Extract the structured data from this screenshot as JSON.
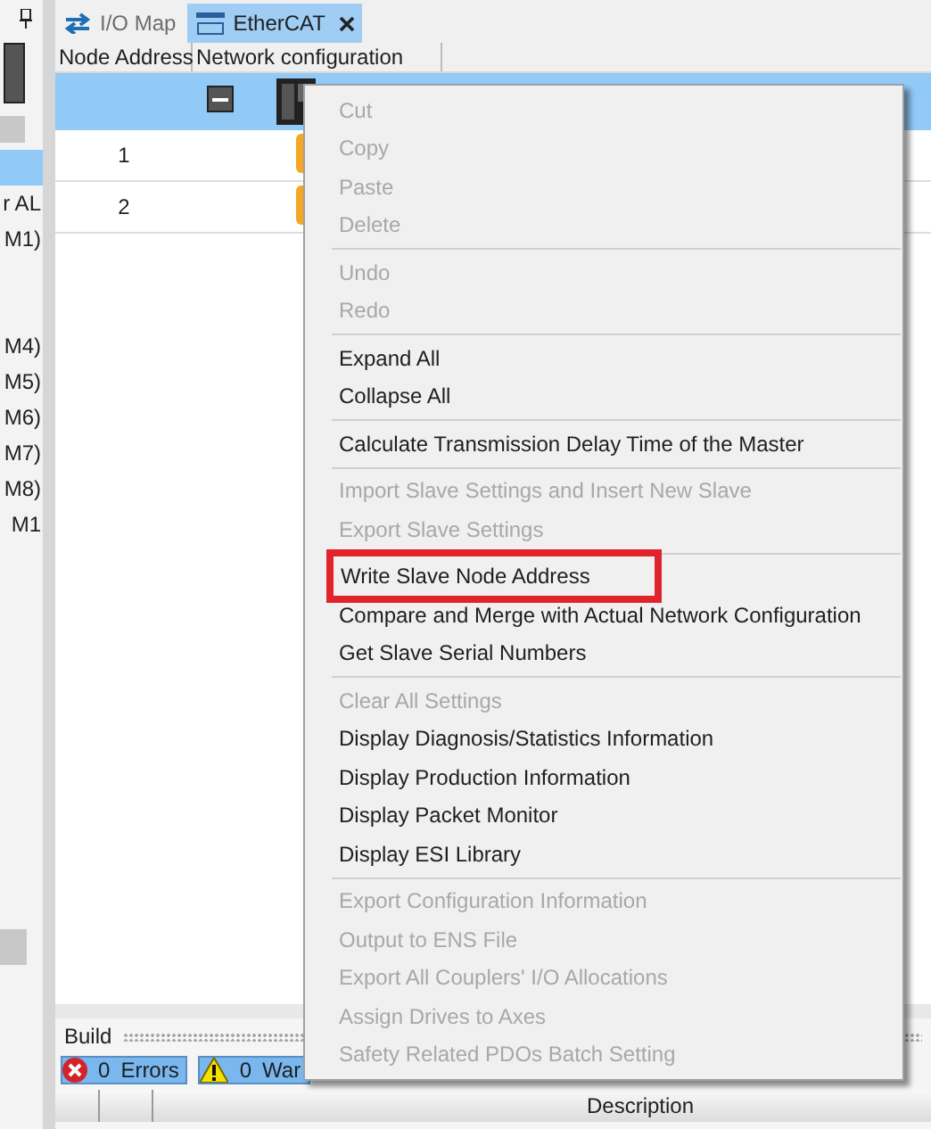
{
  "left_panel": {
    "tree_items": [
      {
        "selected": true
      },
      {
        "label": "r AL",
        "selected": false
      },
      {
        "label": "M1)",
        "selected": false
      },
      {
        "label": "M4)",
        "selected": false
      },
      {
        "label": "M5)",
        "selected": false
      },
      {
        "label": "M6)",
        "selected": false
      },
      {
        "label": "M7)",
        "selected": false
      },
      {
        "label": "M8)",
        "selected": false
      },
      {
        "label": "M1",
        "selected": false
      }
    ]
  },
  "tabs": [
    {
      "label": "I/O Map",
      "selected": false
    },
    {
      "label": "EtherCAT",
      "selected": true
    }
  ],
  "table": {
    "columns": [
      "Node Address",
      "Network configuration"
    ],
    "rows": [
      {
        "node_address": "1"
      },
      {
        "node_address": "2"
      }
    ]
  },
  "context_menu": [
    {
      "kind": "item",
      "label": "Cut",
      "disabled": true,
      "outlined": false
    },
    {
      "kind": "item",
      "label": "Copy",
      "disabled": true,
      "outlined": false
    },
    {
      "kind": "item",
      "label": "Paste",
      "disabled": true,
      "outlined": false
    },
    {
      "kind": "item",
      "label": "Delete",
      "disabled": true,
      "outlined": false
    },
    {
      "kind": "separator"
    },
    {
      "kind": "item",
      "label": "Undo",
      "disabled": true,
      "outlined": false
    },
    {
      "kind": "item",
      "label": "Redo",
      "disabled": true,
      "outlined": false
    },
    {
      "kind": "separator"
    },
    {
      "kind": "item",
      "label": "Expand All",
      "disabled": false,
      "outlined": false
    },
    {
      "kind": "item",
      "label": "Collapse All",
      "disabled": false,
      "outlined": false
    },
    {
      "kind": "separator"
    },
    {
      "kind": "item",
      "label": "Calculate Transmission Delay Time of the Master",
      "disabled": false,
      "outlined": false
    },
    {
      "kind": "separator"
    },
    {
      "kind": "item",
      "label": "Import Slave Settings and Insert New Slave",
      "disabled": true,
      "outlined": false
    },
    {
      "kind": "item",
      "label": "Export Slave Settings",
      "disabled": true,
      "outlined": false
    },
    {
      "kind": "separator"
    },
    {
      "kind": "item",
      "label": "Write Slave Node Address",
      "disabled": false,
      "outlined": true
    },
    {
      "kind": "item",
      "label": "Compare and Merge with Actual Network Configuration",
      "disabled": false,
      "outlined": false
    },
    {
      "kind": "item",
      "label": "Get Slave Serial Numbers",
      "disabled": false,
      "outlined": false
    },
    {
      "kind": "separator"
    },
    {
      "kind": "item",
      "label": "Clear All Settings",
      "disabled": true,
      "outlined": false
    },
    {
      "kind": "item",
      "label": "Display Diagnosis/Statistics Information",
      "disabled": false,
      "outlined": false
    },
    {
      "kind": "item",
      "label": "Display Production Information",
      "disabled": false,
      "outlined": false
    },
    {
      "kind": "item",
      "label": "Display Packet Monitor",
      "disabled": false,
      "outlined": false
    },
    {
      "kind": "item",
      "label": "Display ESI Library",
      "disabled": false,
      "outlined": false
    },
    {
      "kind": "separator"
    },
    {
      "kind": "item",
      "label": "Export Configuration Information",
      "disabled": true,
      "outlined": false
    },
    {
      "kind": "item",
      "label": "Output to ENS File",
      "disabled": true,
      "outlined": false
    },
    {
      "kind": "item",
      "label": "Export All Couplers' I/O Allocations",
      "disabled": true,
      "outlined": false
    },
    {
      "kind": "item",
      "label": "Assign Drives to Axes",
      "disabled": true,
      "outlined": false
    },
    {
      "kind": "item",
      "label": "Safety Related PDOs Batch Setting",
      "disabled": true,
      "outlined": false
    }
  ],
  "build": {
    "title": "Build",
    "filters": [
      {
        "kind": "errors",
        "count": "0",
        "label": "Errors"
      },
      {
        "kind": "warnings",
        "count": "0",
        "label": "War"
      }
    ],
    "columns": [
      "Description"
    ]
  }
}
